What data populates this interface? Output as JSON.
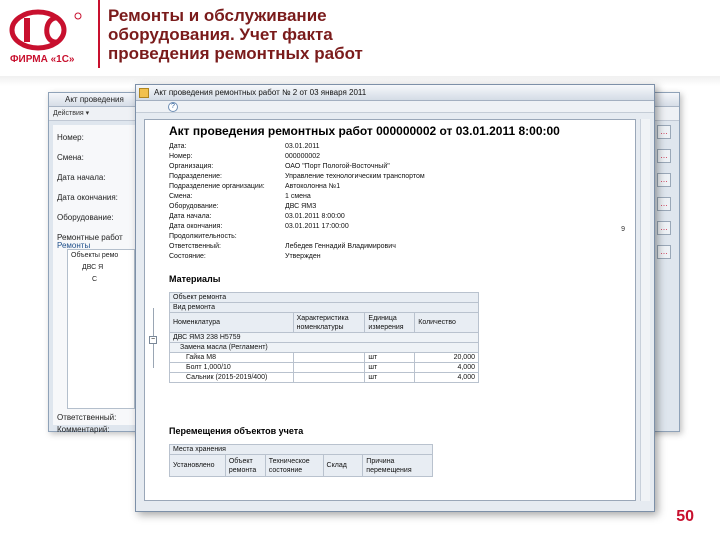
{
  "slide": {
    "logo_caption": "ФИРМА «1С»",
    "title": "Ремонты и обслуживание\nоборудования. Учет факта\nпроведения ремонтных работ",
    "page_number": "50",
    "brand_color": "#c8102e"
  },
  "back_window": {
    "title": "Акт проведения",
    "tabs": "Действия ▾",
    "labels": [
      "Номер:",
      "Смена:",
      "Дата начала:",
      "Дата окончания:",
      "Оборудование:",
      "Ремонтные работ",
      "Ремонты",
      "Ответственный:",
      "Комментарий:"
    ],
    "tree_rows": [
      "Объекты ремо",
      "ДВС Я",
      "С"
    ],
    "right_buttons": [
      "…",
      "…",
      "…",
      "…",
      "…",
      "…"
    ]
  },
  "front_window": {
    "title": "Акт проведения ремонтных работ № 2 от 03 января 2011",
    "help_icon": "?",
    "doc": {
      "heading": "Акт проведения ремонтных работ 000000002 от 03.01.2011 8:00:00",
      "fields": [
        {
          "label": "Дата:",
          "value": "03.01.2011"
        },
        {
          "label": "Номер:",
          "value": "000000002"
        },
        {
          "label": "Организация:",
          "value": "ОАО \"Порт Пологой-Восточный\""
        },
        {
          "label": "Подразделение:",
          "value": "Управление технологическим транспортом"
        },
        {
          "label": "Подразделение организации:",
          "value": "Автоколонна №1"
        },
        {
          "label": "Смена:",
          "value": "1 смена"
        },
        {
          "label": "Оборудование:",
          "value": "ДВС ЯМЗ"
        },
        {
          "label": "Дата начала:",
          "value": "03.01.2011 8:00:00"
        },
        {
          "label": "Дата окончания:",
          "value": "03.01.2011 17:00:00"
        },
        {
          "label": "Продолжительность:",
          "value": ""
        },
        {
          "label": "Ответственный:",
          "value": "Лебедев Геннадий Владимирович"
        },
        {
          "label": "Состояние:",
          "value": "Утвержден"
        }
      ],
      "right_mark": "9",
      "materials_title": "Материалы",
      "materials_rows_top": [
        "Объект ремонта",
        "Вид ремонта"
      ],
      "materials_headers": [
        "Номенклатура",
        "Характеристика номенклатуры",
        "Единица измерения",
        "Количество"
      ],
      "materials_group": "ДВС ЯМЗ 238 Н5759",
      "materials_subgroup": "Замена масла (Регламент)",
      "materials_items": [
        {
          "name": "Гайка М8",
          "char": "",
          "unit": "шт",
          "qty": "20,000"
        },
        {
          "name": "Болт 1,000/10",
          "char": "",
          "unit": "шт",
          "qty": "4,000"
        },
        {
          "name": "Сальник (2015-2019/400)",
          "char": "",
          "unit": "шт",
          "qty": "4,000"
        }
      ],
      "movement_title": "Перемещения объектов учета",
      "movement_top": "Места хранения",
      "movement_headers": [
        "Установлено",
        "Объект ремонта",
        "Техническое состояние",
        "Склад",
        "Причина перемещения"
      ]
    }
  }
}
